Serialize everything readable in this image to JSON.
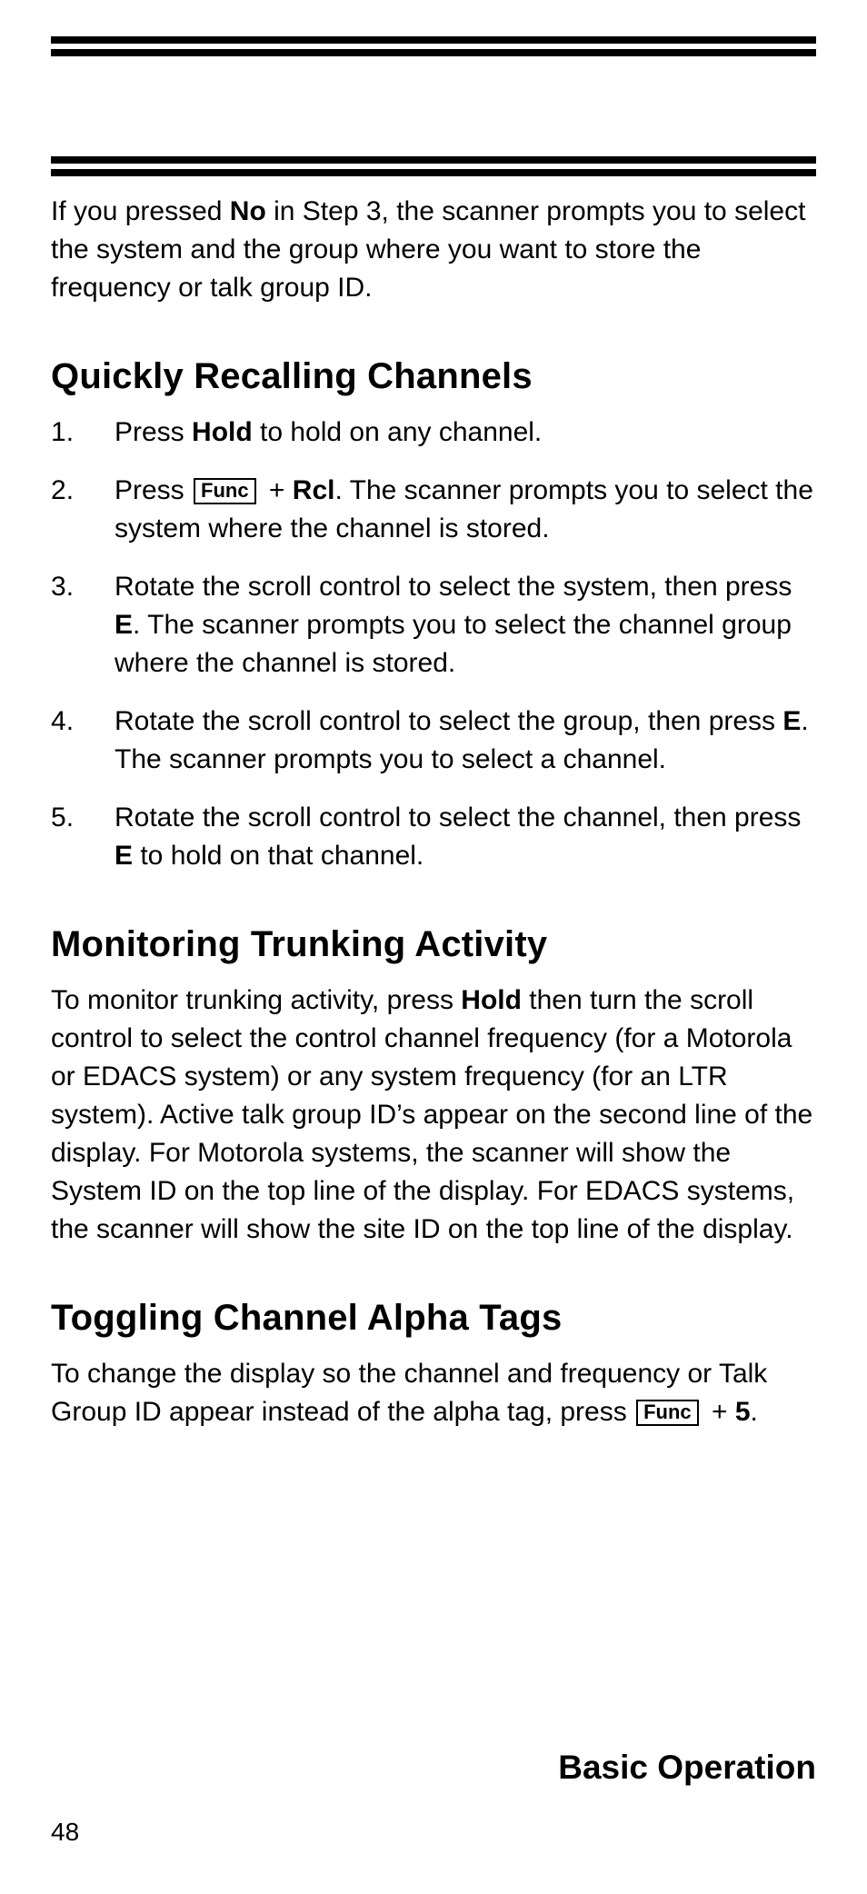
{
  "labels": {
    "func": "Func"
  },
  "intro": {
    "t1": "If you pressed ",
    "no": "No",
    "t2": " in Step 3, the scanner prompts you to select the system and the group where you want to store the frequency or talk group ID."
  },
  "s1": {
    "heading": "Quickly Recalling Channels",
    "li1": {
      "a": "Press ",
      "hold": "Hold",
      "b": " to hold on any channel."
    },
    "li2": {
      "a": "Press ",
      "b": " + ",
      "rcl": "Rcl",
      "c": ". The scanner prompts you to select the system where the channel is stored."
    },
    "li3": {
      "a": "Rotate the scroll control to select the system, then press ",
      "e": "E",
      "b": ". The scanner prompts you to select the channel group where the channel is stored."
    },
    "li4": {
      "a": "Rotate the scroll control to select the group, then press ",
      "e": "E",
      "b": ". The scanner prompts you to select a channel."
    },
    "li5": {
      "a": "Rotate the scroll control to select the channel, then press ",
      "e": "E",
      "b": " to hold on that channel."
    }
  },
  "s2": {
    "heading": "Monitoring Trunking Activity",
    "p": {
      "a": "To monitor trunking activity, press ",
      "hold": "Hold",
      "b": " then turn the scroll control to select the control channel frequency (for a Motorola or EDACS system) or any system frequency (for an LTR system). Active talk group ID’s appear on the second line of the display. For Motorola systems, the scanner will show the System ID on the top line of the display. For EDACS systems, the scanner will show the site ID on the top line of the display."
    }
  },
  "s3": {
    "heading": "Toggling Channel Alpha Tags",
    "p": {
      "a": "To change the display so the channel and frequency or Talk Group ID appear instead of the alpha tag, press ",
      "b": " + ",
      "five": "5",
      "c": "."
    }
  },
  "footer": {
    "title": "Basic Operation",
    "page": "48"
  }
}
